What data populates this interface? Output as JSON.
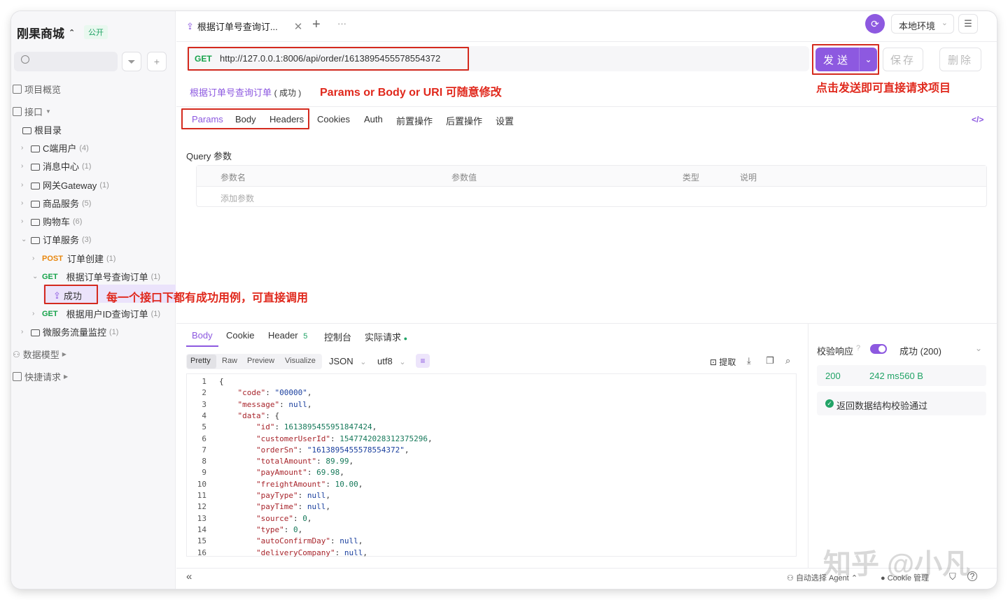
{
  "sidebar": {
    "project": "刚果商城",
    "badge": "公开",
    "overview": "项目概览",
    "interfaces": "接口",
    "tree": [
      {
        "label": "根目录"
      },
      {
        "label": "C端用户",
        "count": "(4)"
      },
      {
        "label": "消息中心",
        "count": "(1)"
      },
      {
        "label": "网关Gateway",
        "count": "(1)"
      },
      {
        "label": "商品服务",
        "count": "(5)"
      },
      {
        "label": "购物车",
        "count": "(6)"
      },
      {
        "label": "订单服务",
        "count": "(3)"
      },
      {
        "method": "POST",
        "label": "订单创建",
        "count": "(1)"
      },
      {
        "method": "GET",
        "label": "根据订单号查询订单",
        "count": "(1)"
      },
      {
        "label": "成功"
      },
      {
        "method": "GET",
        "label": "根据用户ID查询订单",
        "count": "(1)"
      },
      {
        "label": "微服务流量监控",
        "count": "(1)"
      }
    ],
    "data_model": "数据模型",
    "quick_request": "快捷请求"
  },
  "tabs": {
    "active": "根据订单号查询订...",
    "plus": "+",
    "more": "···"
  },
  "env": {
    "label": "本地环境"
  },
  "request": {
    "method": "GET",
    "url": "http://127.0.0.1:8006/api/order/1613895455578554372",
    "send": "发送",
    "save": "保存",
    "delete": "删除",
    "breadcrumb_name": "根据订单号查询订单",
    "breadcrumb_case": "( 成功 )"
  },
  "annotations": {
    "params": "Params or Body or URI 可随意修改",
    "send": "点击发送即可直接请求项目",
    "case": "每一个接口下都有成功用例，可直接调用"
  },
  "req_tabs": [
    "Params",
    "Body",
    "Headers",
    "Cookies",
    "Auth",
    "前置操作",
    "后置操作",
    "设置"
  ],
  "query": {
    "title": "Query 参数",
    "columns": [
      "参数名",
      "参数值",
      "类型",
      "说明"
    ],
    "add": "添加参数"
  },
  "response": {
    "tabs": [
      "Body",
      "Cookie",
      "Header",
      "控制台",
      "实际请求"
    ],
    "header_count": "5",
    "modes": [
      "Pretty",
      "Raw",
      "Preview",
      "Visualize"
    ],
    "format": "JSON",
    "encoding": "utf8",
    "extract": "提取",
    "code_lines": [
      {
        "n": "1",
        "t": "{"
      },
      {
        "n": "2",
        "k": "\"code\"",
        "v": "\"00000\"",
        "c": "s"
      },
      {
        "n": "3",
        "k": "\"message\"",
        "v": "null",
        "c": "nl"
      },
      {
        "n": "4",
        "k": "\"data\"",
        "v": "{",
        "c": "p"
      },
      {
        "n": "5",
        "k": "\"id\"",
        "v": "1613895455951847424",
        "c": "n",
        "i": 2
      },
      {
        "n": "6",
        "k": "\"customerUserId\"",
        "v": "1547742028312375296",
        "c": "n",
        "i": 2
      },
      {
        "n": "7",
        "k": "\"orderSn\"",
        "v": "\"1613895455578554372\"",
        "c": "s",
        "i": 2
      },
      {
        "n": "8",
        "k": "\"totalAmount\"",
        "v": "89.99",
        "c": "n",
        "i": 2
      },
      {
        "n": "9",
        "k": "\"payAmount\"",
        "v": "69.98",
        "c": "n",
        "i": 2
      },
      {
        "n": "10",
        "k": "\"freightAmount\"",
        "v": "10.00",
        "c": "n",
        "i": 2
      },
      {
        "n": "11",
        "k": "\"payType\"",
        "v": "null",
        "c": "nl",
        "i": 2
      },
      {
        "n": "12",
        "k": "\"payTime\"",
        "v": "null",
        "c": "nl",
        "i": 2
      },
      {
        "n": "13",
        "k": "\"source\"",
        "v": "0",
        "c": "n",
        "i": 2
      },
      {
        "n": "14",
        "k": "\"type\"",
        "v": "0",
        "c": "n",
        "i": 2
      },
      {
        "n": "15",
        "k": "\"autoConfirmDay\"",
        "v": "null",
        "c": "nl",
        "i": 2
      },
      {
        "n": "16",
        "k": "\"deliveryCompany\"",
        "v": "null",
        "c": "nl",
        "i": 2
      }
    ],
    "validate_label": "校验响应",
    "validate_status": "成功 (200)",
    "status": "200",
    "time": "242 ms",
    "size": "560 B",
    "validate_ok": "返回数据结构校验通过"
  },
  "footer": {
    "agent": "自动选择 Agent",
    "cookie": "Cookie 管理",
    "collapse": "«"
  },
  "watermark": "知乎 @小凡",
  "colors": {
    "accent": "#8d59e0",
    "annotation": "#e0281c",
    "get": "#16a34a",
    "post": "#e8870e"
  }
}
